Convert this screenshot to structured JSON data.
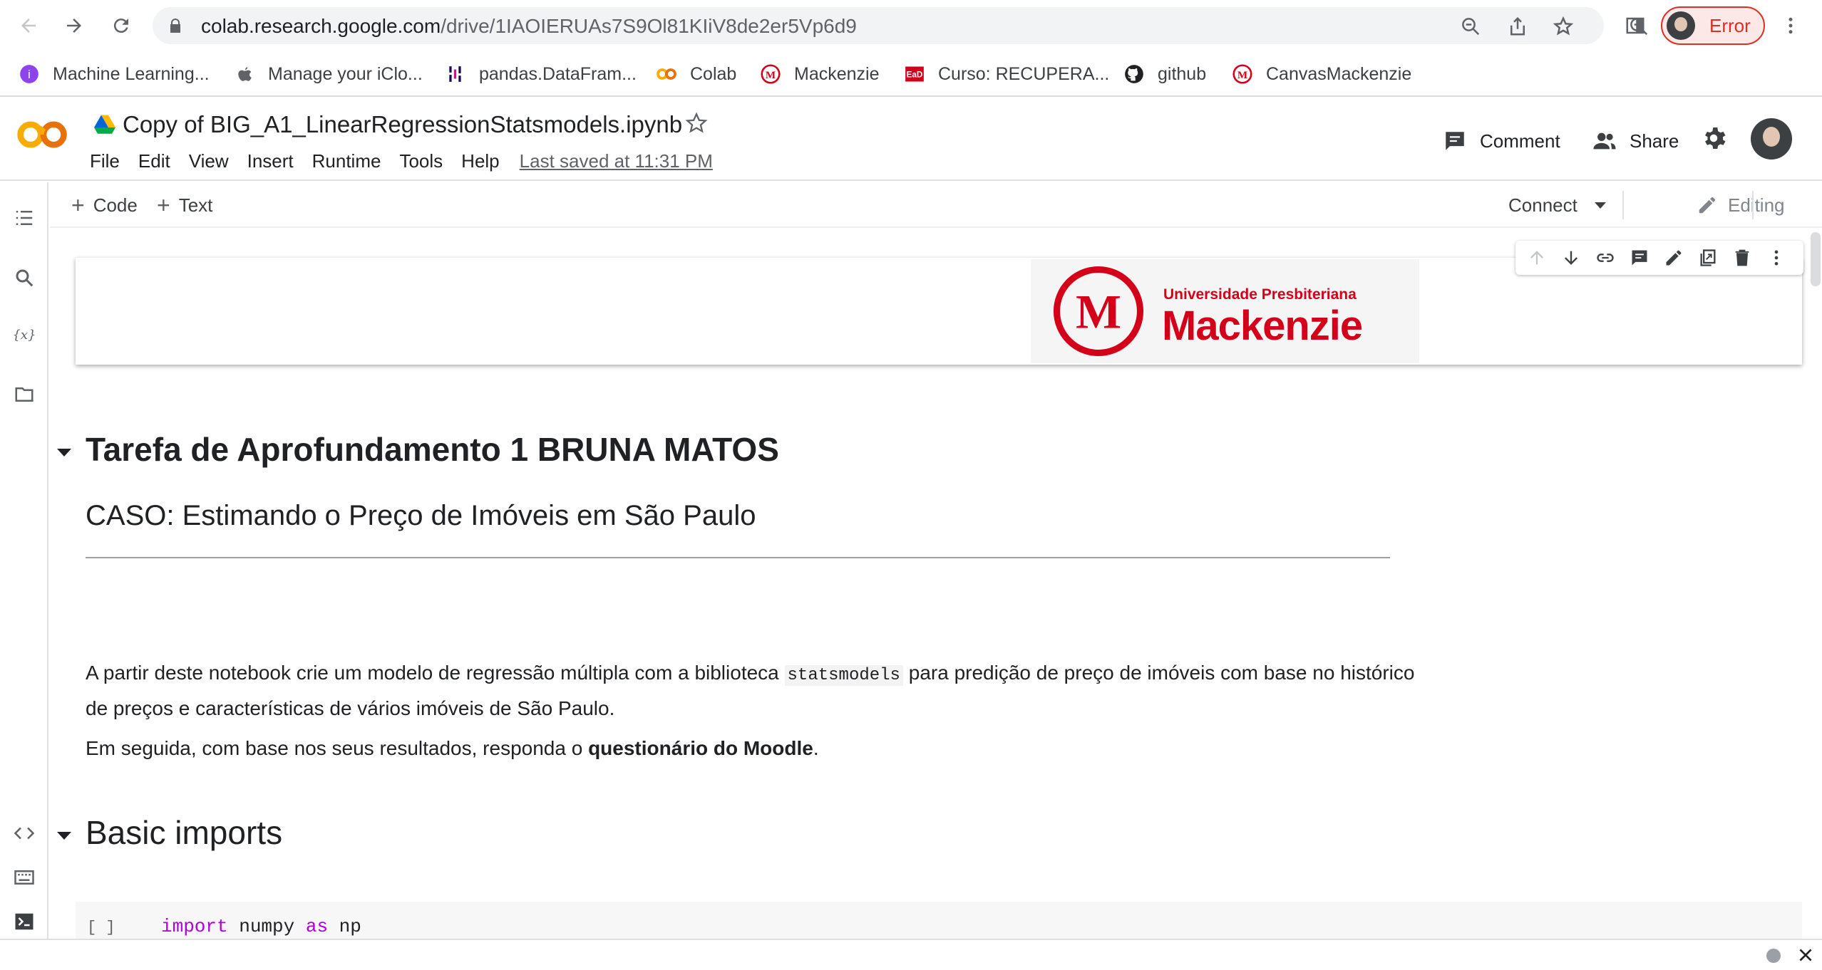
{
  "browser": {
    "url_domain": "colab.research.google.com",
    "url_path": "/drive/1IAOIERUAs7S9Ol81KIiV8de2er5Vp6d9",
    "profile_status": "Error",
    "bookmarks": [
      {
        "label": "Machine Learning...",
        "icon": "ml-icon"
      },
      {
        "label": "Manage your iClo...",
        "icon": "apple-icon"
      },
      {
        "label": "pandas.DataFram...",
        "icon": "pandas-icon"
      },
      {
        "label": "Colab",
        "icon": "colab-icon"
      },
      {
        "label": "Mackenzie",
        "icon": "mackenzie-icon"
      },
      {
        "label": "Curso: RECUPERA...",
        "icon": "ead-icon"
      },
      {
        "label": "github",
        "icon": "github-icon"
      },
      {
        "label": "CanvasMackenzie",
        "icon": "mackenzie-icon"
      }
    ]
  },
  "colab": {
    "notebook_title": "Copy of BIG_A1_LinearRegressionStatsmodels.ipynb",
    "menu": [
      "File",
      "Edit",
      "View",
      "Insert",
      "Runtime",
      "Tools",
      "Help"
    ],
    "last_saved": "Last saved at 11:31 PM",
    "comment_label": "Comment",
    "share_label": "Share",
    "add_code_label": "Code",
    "add_text_label": "Text",
    "connect_label": "Connect",
    "editing_label": "Editing"
  },
  "logo": {
    "subtitle": "Universidade Presbiteriana",
    "name": "Mackenzie",
    "color": "#d4001a"
  },
  "content": {
    "heading1": "Tarefa de Aprofundamento 1 BRUNA MATOS",
    "heading2": "CASO: Estimando o Preço de Imóveis em São Paulo",
    "para1_before": "A partir deste notebook crie um modelo de regressão múltipla com a biblioteca ",
    "para1_code": "statsmodels",
    "para1_after": " para predição de preço de imóveis com base no histórico de preços e características de vários imóveis de São Paulo.",
    "para2_before": "Em seguida, com base nos seus resultados, responda o ",
    "para2_bold": "questionário do Moodle",
    "para2_after": ".",
    "heading_basic": "Basic imports",
    "code_run_label": "[ ]",
    "code_kw_import": "import",
    "code_module": " numpy ",
    "code_kw_as": "as",
    "code_alias": " np"
  }
}
